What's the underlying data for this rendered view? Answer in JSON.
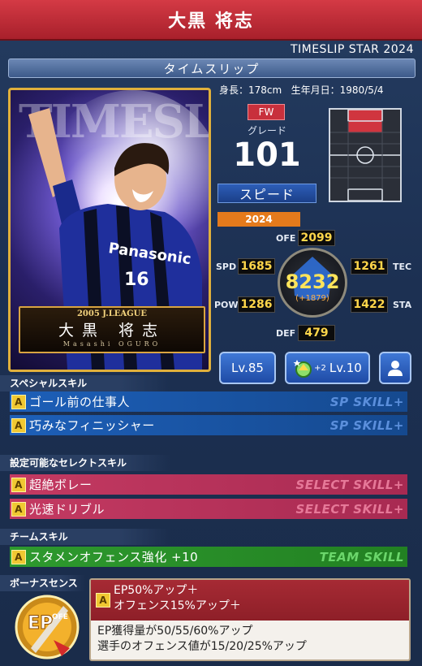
{
  "header": {
    "title": "大黒 将志"
  },
  "series": "TIMESLIP STAR 2024",
  "kind": "タイムスリップ",
  "card": {
    "bg_text": "TIMESLIP",
    "league": "2005 J.LEAGUE",
    "name_jp": "大黒 将志",
    "name_en": "Masashi OGURO",
    "shirt_text": "Panasonic",
    "shirt_number": "16"
  },
  "profile": {
    "height": "身長：178cm",
    "birthdate": "生年月日：1980/5/4"
  },
  "position": "FW",
  "grade_label": "グレード",
  "grade": "101",
  "type": "スピード",
  "year": "2024",
  "stats": {
    "ofe": {
      "label": "OFE",
      "value": "2099"
    },
    "spd": {
      "label": "SPD",
      "value": "1685"
    },
    "tec": {
      "label": "TEC",
      "value": "1261"
    },
    "pow": {
      "label": "POW",
      "value": "1286"
    },
    "sta": {
      "label": "STA",
      "value": "1422"
    },
    "def": {
      "label": "DEF",
      "value": "479"
    },
    "total": "8232",
    "total_diff": "(+1879)"
  },
  "buttons": {
    "level": "Lv.85",
    "skill_plus": "+2",
    "skill_level": "Lv.10"
  },
  "special": {
    "heading": "スペシャルスキル",
    "tag": "SP SKILL+",
    "items": [
      {
        "rank": "A",
        "name": "ゴール前の仕事人"
      },
      {
        "rank": "A",
        "name": "巧みなフィニッシャー"
      }
    ]
  },
  "select": {
    "heading": "設定可能なセレクトスキル",
    "tag": "SELECT SKILL+",
    "items": [
      {
        "rank": "A",
        "name": "超絶ボレー"
      },
      {
        "rank": "A",
        "name": "光速ドリブル"
      }
    ]
  },
  "team": {
    "heading": "チームスキル",
    "tag": "TEAM SKILL",
    "items": [
      {
        "rank": "A",
        "name": "スタメンオフェンス強化 +10"
      }
    ]
  },
  "bonus": {
    "heading": "ボーナスセンス",
    "rank": "A",
    "line1": "EP50%アップ＋",
    "line2": "オフェンス15%アップ＋",
    "desc1": "EP獲得量が50/55/60%アップ",
    "desc2": "選手のオフェンス値が15/20/25%アップ",
    "icon_text": "EP",
    "icon_sub": "OFE"
  },
  "colors": {
    "header_red": "#c0303a",
    "sp_blue": "#1d5fb8",
    "select_pink": "#c43a62",
    "team_green": "#2e9a2e"
  }
}
